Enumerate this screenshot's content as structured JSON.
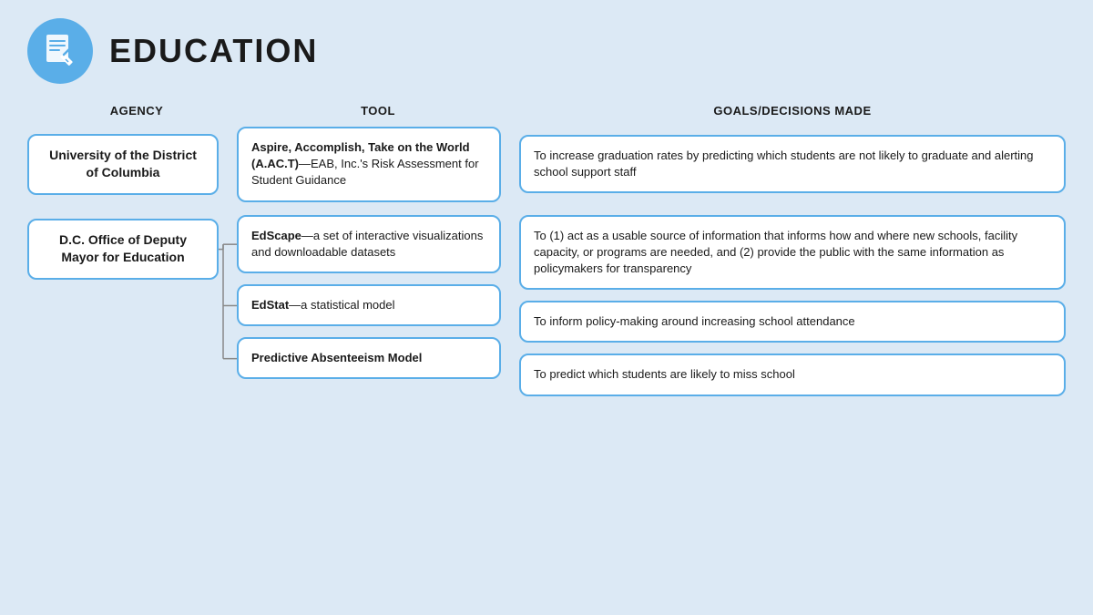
{
  "header": {
    "title": "EDUCATION",
    "icon_label": "education-document-icon"
  },
  "columns": {
    "agency": "AGENCY",
    "tool": "TOOL",
    "goals": "GOALS/DECISIONS MADE"
  },
  "rows": [
    {
      "agency": "University of the District of Columbia",
      "tool_bold": "Aspire, Accomplish, Take on the World (A.AC.T)",
      "tool_rest": "—EAB, Inc.'s Risk Assessment for Student Guidance",
      "goal": "To increase graduation rates by predicting which students are not likely to graduate and alerting school support staff"
    },
    {
      "agency": "D.C. Office of Deputy Mayor for Education",
      "tools": [
        {
          "bold": "EdScape",
          "rest": "—a set of interactive visualizations and downloadable datasets"
        },
        {
          "bold": "EdStat",
          "rest": "—a statistical model"
        },
        {
          "bold": "Predictive Absenteeism Model",
          "rest": ""
        }
      ],
      "goals": [
        "To (1) act as a usable source of information that informs how and where new schools, facility capacity, or programs are needed, and (2) provide the public with the same information as policymakers for transparency",
        "To inform policy-making around increasing school attendance",
        "To predict which students are likely to miss school"
      ]
    }
  ]
}
